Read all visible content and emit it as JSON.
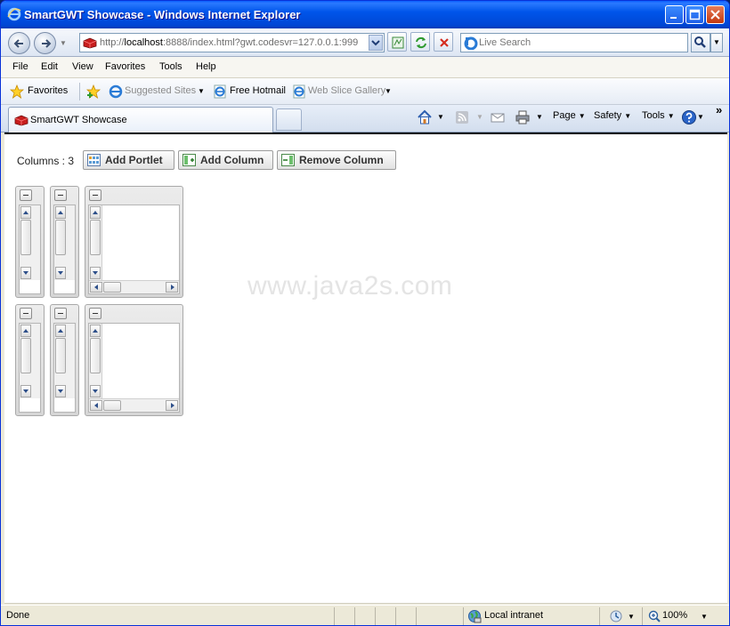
{
  "window": {
    "title": "SmartGWT Showcase - Windows Internet Explorer"
  },
  "address": {
    "url_prefix": "http://",
    "url_host": "localhost",
    "url_rest": ":8888/index.html?gwt.codesvr=127.0.0.1:999"
  },
  "search": {
    "placeholder": "Live Search"
  },
  "menu": {
    "file": "File",
    "edit": "Edit",
    "view": "View",
    "favorites": "Favorites",
    "tools": "Tools",
    "help": "Help"
  },
  "favorites_bar": {
    "favorites": "Favorites",
    "suggested_sites": "Suggested Sites",
    "free_hotmail": "Free Hotmail",
    "web_slice_gallery": "Web Slice Gallery"
  },
  "tab": {
    "title": "SmartGWT Showcase"
  },
  "command_bar": {
    "page": "Page",
    "safety": "Safety",
    "tools": "Tools",
    "chevron": "»"
  },
  "page": {
    "columns_label": "Columns : 3",
    "add_portlet": "Add Portlet",
    "add_column": "Add Column",
    "remove_column": "Remove Column",
    "watermark": "www.java2s.com"
  },
  "portlet_colors": {
    "row1_col1": "#4a8fd4",
    "row1_col2": "#3ec43e",
    "row2_col1": "#2aa6a6",
    "row2_col2": "#1a6b6b"
  },
  "status": {
    "done": "Done",
    "zone": "Local intranet",
    "zoom": "100%"
  }
}
